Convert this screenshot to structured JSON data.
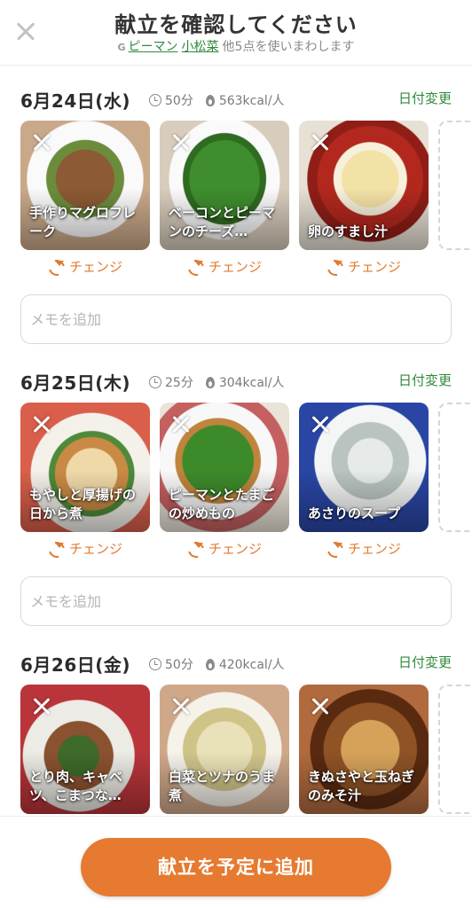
{
  "header": {
    "title": "献立を確認してください",
    "g_label": "G",
    "ingredients": [
      "ピーマン",
      "小松菜"
    ],
    "subtitle_rest": "他5点を使いまわします"
  },
  "days": [
    {
      "date": "6月24日(水)",
      "time": "50分",
      "kcal": "563kcal/人",
      "date_change": "日付変更",
      "dishes": [
        {
          "name": "手作りマグロフレーク",
          "change": "チェンジ"
        },
        {
          "name": "ベーコンとピーマンのチーズ…",
          "change": "チェンジ"
        },
        {
          "name": "卵のすまし汁",
          "change": "チェンジ"
        }
      ],
      "memo_placeholder": "メモを追加"
    },
    {
      "date": "6月25日(木)",
      "time": "25分",
      "kcal": "304kcal/人",
      "date_change": "日付変更",
      "dishes": [
        {
          "name": "もやしと厚揚げの日から煮",
          "change": "チェンジ"
        },
        {
          "name": "ピーマンとたまごの炒めもの",
          "change": "チェンジ"
        },
        {
          "name": "あさりのスープ",
          "change": "チェンジ"
        }
      ],
      "memo_placeholder": "メモを追加"
    },
    {
      "date": "6月26日(金)",
      "time": "50分",
      "kcal": "420kcal/人",
      "date_change": "日付変更",
      "dishes": [
        {
          "name": "とり肉、キャベツ、こまつな…"
        },
        {
          "name": "白菜とツナのうま煮"
        },
        {
          "name": "きぬさやと玉ねぎのみそ汁"
        }
      ]
    }
  ],
  "footer": {
    "submit_label": "献立を予定に追加"
  }
}
